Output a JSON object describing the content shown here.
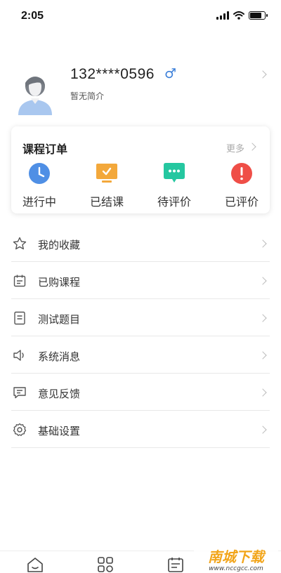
{
  "status_bar": {
    "time": "2:05",
    "battery_level": 0.8
  },
  "profile": {
    "phone": "132****0596",
    "gender_symbol": "♂",
    "bio": "暂无简介"
  },
  "orders": {
    "title": "课程订单",
    "more": "更多",
    "items": [
      {
        "label": "进行中",
        "icon": "clock-icon",
        "color": "#4f8fe5"
      },
      {
        "label": "已结课",
        "icon": "monitor-check-icon",
        "color": "#f3a83b"
      },
      {
        "label": "待评价",
        "icon": "chat-dots-icon",
        "color": "#25c7a0"
      },
      {
        "label": "已评价",
        "icon": "exclamation-icon",
        "color": "#ef4e47"
      }
    ]
  },
  "menu": [
    {
      "label": "我的收藏",
      "icon": "star-icon"
    },
    {
      "label": "已购课程",
      "icon": "calendar-icon"
    },
    {
      "label": "测试题目",
      "icon": "document-icon"
    },
    {
      "label": "系统消息",
      "icon": "speaker-icon"
    },
    {
      "label": "意见反馈",
      "icon": "feedback-icon"
    },
    {
      "label": "基础设置",
      "icon": "gear-icon"
    }
  ],
  "tabbar": [
    {
      "icon": "home-icon"
    },
    {
      "icon": "category-icon"
    },
    {
      "icon": "schedule-icon"
    }
  ],
  "watermark": {
    "title": "南城下载",
    "subtitle": "www.nccgcc.com"
  }
}
